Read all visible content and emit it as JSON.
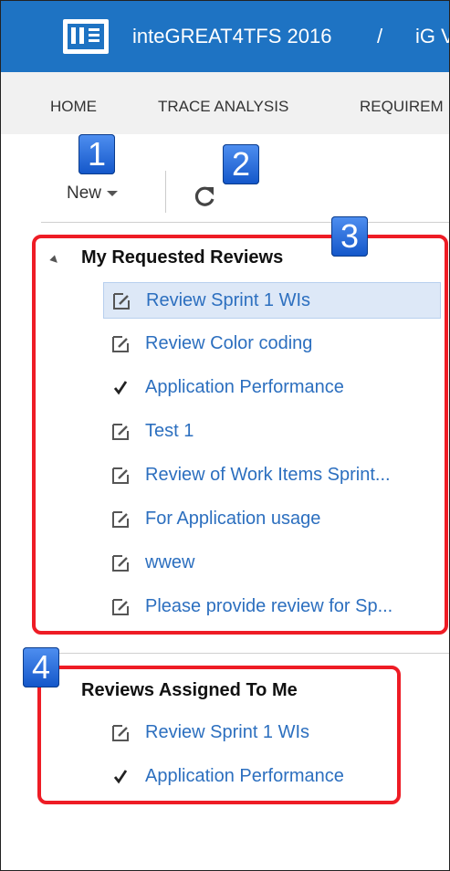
{
  "header": {
    "app_title": "inteGREAT4TFS 2016",
    "separator": "/",
    "project_crumb": "iG V"
  },
  "nav": {
    "tabs": [
      {
        "label": "HOME"
      },
      {
        "label": "TRACE ANALYSIS"
      },
      {
        "label": "REQUIREM"
      }
    ]
  },
  "toolbar": {
    "new_label": "New"
  },
  "callouts": [
    "1",
    "2",
    "3",
    "4"
  ],
  "my_requested": {
    "title": "My Requested Reviews",
    "items": [
      {
        "label": "Review Sprint 1 WIs",
        "icon": "edit-icon",
        "selected": true
      },
      {
        "label": "Review Color coding",
        "icon": "edit-icon"
      },
      {
        "label": "Application Performance",
        "icon": "checkmark-icon"
      },
      {
        "label": "Test 1",
        "icon": "edit-icon"
      },
      {
        "label": "Review of Work Items Sprint...",
        "icon": "edit-icon"
      },
      {
        "label": "For Application usage",
        "icon": "edit-icon"
      },
      {
        "label": "wwew",
        "icon": "edit-icon"
      },
      {
        "label": "Please provide review for Sp...",
        "icon": "edit-icon"
      }
    ]
  },
  "assigned_to_me": {
    "title": "Reviews Assigned To Me",
    "items": [
      {
        "label": "Review Sprint 1 WIs",
        "icon": "edit-icon"
      },
      {
        "label": "Application Performance",
        "icon": "checkmark-icon"
      }
    ]
  },
  "colors": {
    "header_bg": "#1e73c3",
    "link": "#2c6fbf",
    "highlight_box": "#ee1c25",
    "callout": "#1e6ad8"
  }
}
